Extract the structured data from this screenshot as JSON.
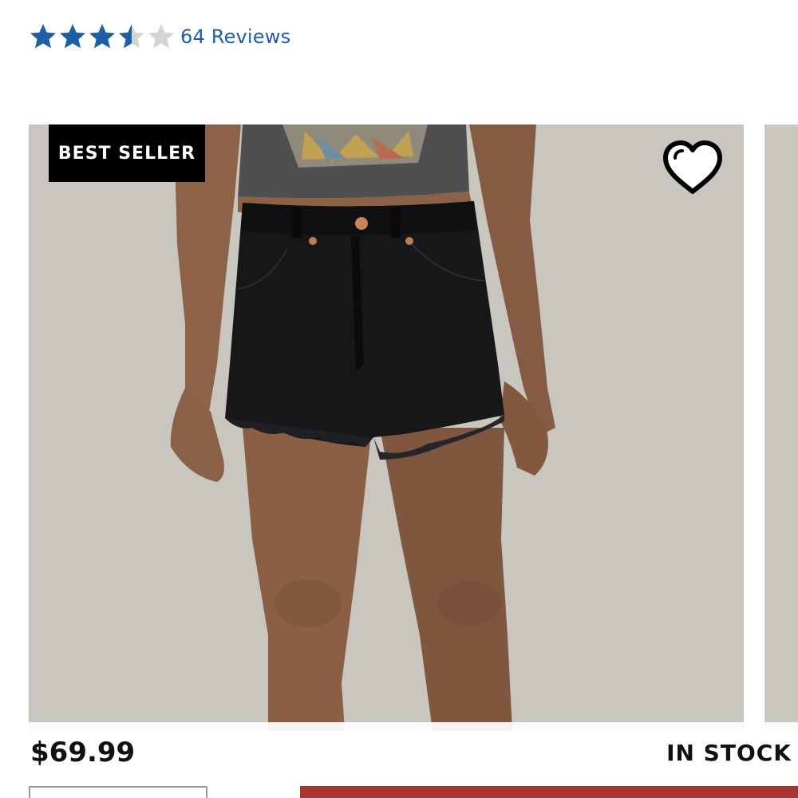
{
  "rating": {
    "value": 3.5,
    "max": 5,
    "reviews_label": "64 Reviews",
    "star_color": "#1d5fa6",
    "empty_color": "#d4d4d4"
  },
  "product": {
    "badge": "BEST SELLER",
    "wishlist_icon": "heart-outline-icon",
    "image_alt": "Black high-rise frayed denim shorts"
  },
  "purchase": {
    "price": "$69.99",
    "stock_status": "IN STOCK",
    "cta_color": "#a8382f"
  }
}
